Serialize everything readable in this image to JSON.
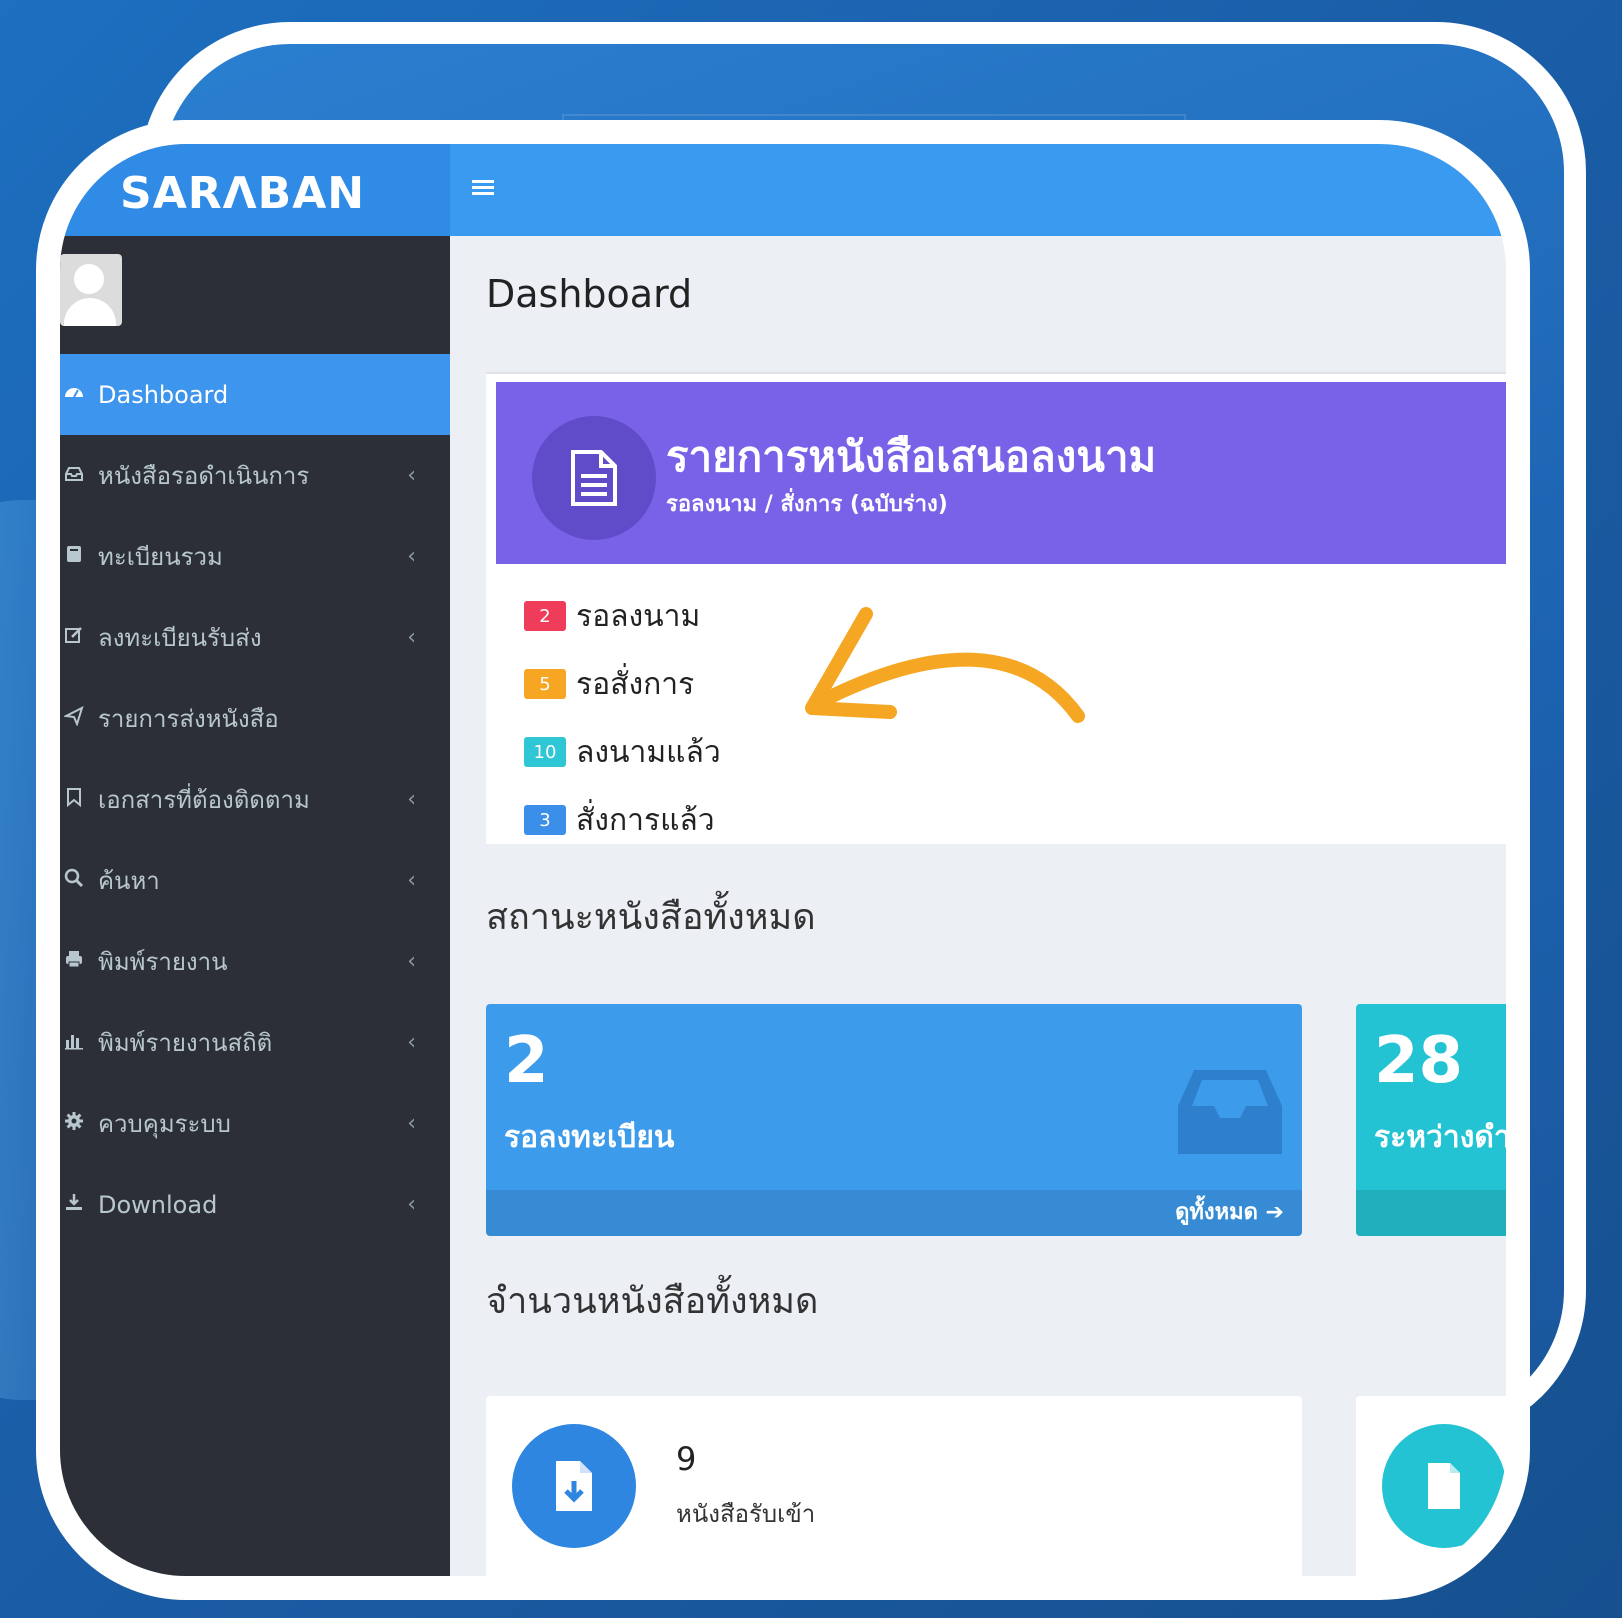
{
  "brand": {
    "logo": "SARΛBAN"
  },
  "colors": {
    "topbar": "#3a9af0",
    "sidebar": "#2c2f38",
    "active": "#3d95ed",
    "sign_header": "#7961e8",
    "badge_red": "#ee3c5a",
    "badge_orange": "#f6a623",
    "badge_teal": "#2fc6d6",
    "badge_blue": "#3b8fe8",
    "stat_blue": "#3d9bec",
    "stat_teal": "#23c3d3",
    "arrow": "#f5a623"
  },
  "sidebar": {
    "items": [
      {
        "label": "Dashboard",
        "icon": "dashboard-icon",
        "active": true
      },
      {
        "label": "หนังสือรอดำเนินการ",
        "icon": "inbox-icon",
        "chevron": "‹"
      },
      {
        "label": "ทะเบียนรวม",
        "icon": "book-icon",
        "chevron": "‹"
      },
      {
        "label": "ลงทะเบียนรับส่ง",
        "icon": "edit-icon",
        "chevron": "‹"
      },
      {
        "label": "รายการส่งหนังสือ",
        "icon": "send-icon"
      },
      {
        "label": "เอกสารที่ต้องติดตาม",
        "icon": "bookmark-icon",
        "chevron": "‹"
      },
      {
        "label": "ค้นหา",
        "icon": "search-icon",
        "chevron": "‹"
      },
      {
        "label": "พิมพ์รายงาน",
        "icon": "print-icon",
        "chevron": "‹"
      },
      {
        "label": "พิมพ์รายงานสถิติ",
        "icon": "bar-chart-icon",
        "chevron": "‹"
      },
      {
        "label": "ควบคุมระบบ",
        "icon": "gear-icon",
        "chevron": "‹"
      },
      {
        "label": "Download",
        "icon": "download-icon",
        "chevron": "‹"
      }
    ]
  },
  "main": {
    "page_title": "Dashboard",
    "sign_card": {
      "title": "รายการหนังสือเสนอลงนาม",
      "subtitle": "รอลงนาม / สั่งการ (ฉบับร่าง)",
      "icon": "document-icon",
      "statuses": [
        {
          "count": "2",
          "label": "รอลงนาม",
          "color": "red"
        },
        {
          "count": "5",
          "label": "รอสั่งการ",
          "color": "orange"
        },
        {
          "count": "10",
          "label": "ลงนามแล้ว",
          "color": "teal"
        },
        {
          "count": "3",
          "label": "สั่งการแล้ว",
          "color": "blue"
        }
      ]
    },
    "status_section_title": "สถานะหนังสือทั้งหมด",
    "stat_boxes": [
      {
        "number": "2",
        "label": "รอลงทะเบียน",
        "footer": "ดูทั้งหมด ➔",
        "icon": "inbox-icon"
      },
      {
        "number": "28",
        "label": "ระหว่างดำ",
        "footer": ""
      }
    ],
    "count_section_title": "จำนวนหนังสือทั้งหมด",
    "info_boxes": [
      {
        "number": "9",
        "label": "หนังสือรับเข้า",
        "icon": "file-download-icon"
      },
      {
        "number": "",
        "label": "",
        "icon": "file-icon"
      }
    ]
  }
}
